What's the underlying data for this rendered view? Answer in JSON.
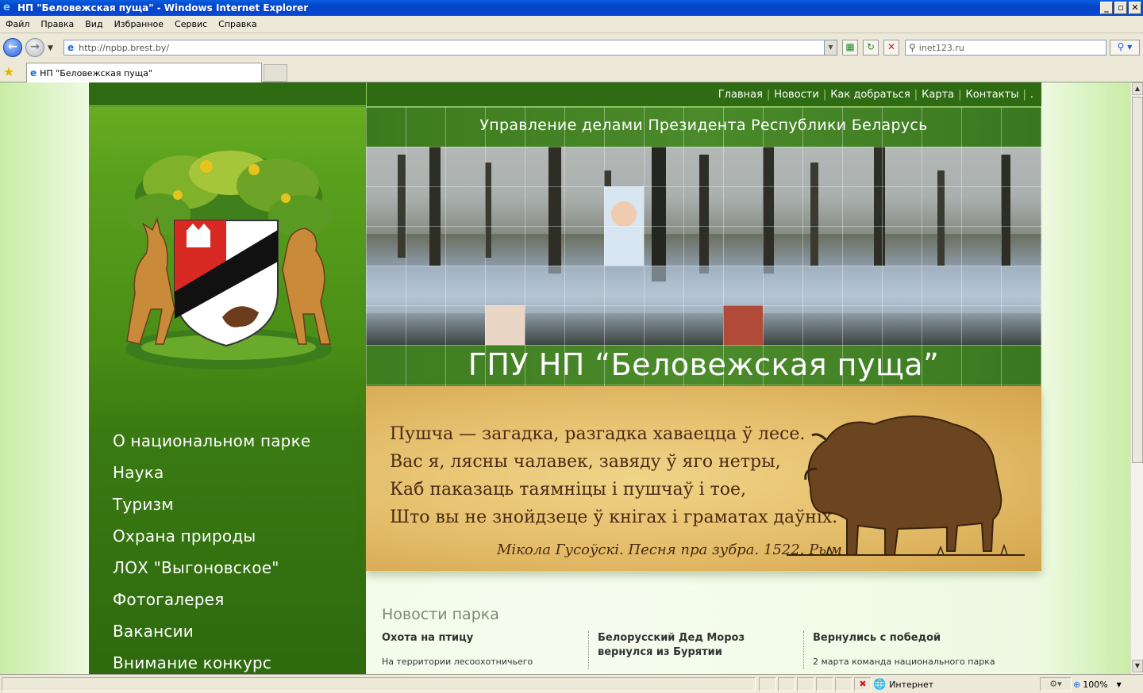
{
  "window": {
    "title": "НП \"Беловежская пуща\" - Windows Internet Explorer",
    "min_glyph": "_",
    "max_glyph": "▫",
    "close_glyph": "✕"
  },
  "menubar": [
    "Файл",
    "Правка",
    "Вид",
    "Избранное",
    "Сервис",
    "Справка"
  ],
  "address": {
    "url": "http://npbp.brest.by/"
  },
  "search": {
    "value": "inet123.ru"
  },
  "tab": {
    "title": "НП \"Беловежская пуща\""
  },
  "icons": {
    "back": "back-arrow-icon",
    "forward": "forward-arrow-icon",
    "refresh": "refresh-icon",
    "stop": "stop-icon",
    "rss": "compatibility-icon",
    "search": "search-icon",
    "favorites": "favorites-star-icon",
    "internet": "globe-icon"
  },
  "site": {
    "topnav": [
      "Главная",
      "Новости",
      "Как добраться",
      "Карта",
      "Контакты",
      "."
    ],
    "gov_title": "Управление делами Президента Республики Беларусь",
    "park_title": "ГПУ НП “Беловежская пуща”",
    "poem": [
      "Пушча — загадка, разгадка хаваецца ў лесе.",
      "Вас я, лясны чалавек, завяду ў яго нетры,",
      "Каб паказаць таямніцы і пушчаў і тое,",
      "Што вы не знойдзеце ў кнігах і граматах даўніх."
    ],
    "poem_author": "Мікола Гусоўскі. Песня пра зубра. 1522. Рым",
    "menu": [
      "О национальном парке",
      "Наука",
      "Туризм",
      "Охрана природы",
      "ЛОХ \"Выгоновское\"",
      "Фотогалерея",
      "Вакансии",
      "Внимание конкурс"
    ],
    "news_heading": "Новости парка",
    "news": [
      {
        "title": "Охота на птицу",
        "text": "На территории лесоохотничьего"
      },
      {
        "title": "Белорусский Дед Мороз вернулся из Бурятии",
        "text": ""
      },
      {
        "title": "Вернулись с победой",
        "text": "2 марта команда  национального парка"
      }
    ]
  },
  "status": {
    "zone": "Интернет",
    "zoom": "100%"
  },
  "colors": {
    "site_dark_green": "#2e6b12",
    "site_bright_green": "#6aac22",
    "parchment": "#e4bd6a",
    "xp_blue": "#0a48d3"
  }
}
